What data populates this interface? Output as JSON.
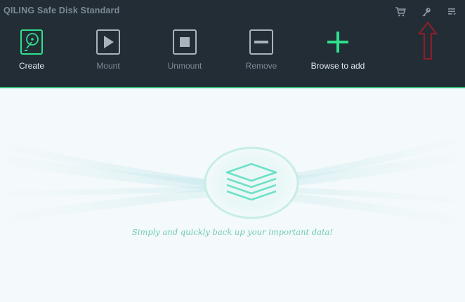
{
  "app": {
    "title": "QILING Safe Disk Standard"
  },
  "top_icons": [
    {
      "name": "cart-icon"
    },
    {
      "name": "key-icon"
    },
    {
      "name": "menu-icon"
    }
  ],
  "toolbar": {
    "create_label": "Create",
    "mount_label": "Mount",
    "unmount_label": "Unmount",
    "remove_label": "Remove",
    "browse_label": "Browse to add"
  },
  "main": {
    "tagline": "Simply and quickly back up your important data!"
  },
  "colors": {
    "header_bg": "#232d36",
    "accent_green": "#2ec07b",
    "annotation_red": "#8a1f2a",
    "tagline_teal": "#6cc9b4"
  }
}
